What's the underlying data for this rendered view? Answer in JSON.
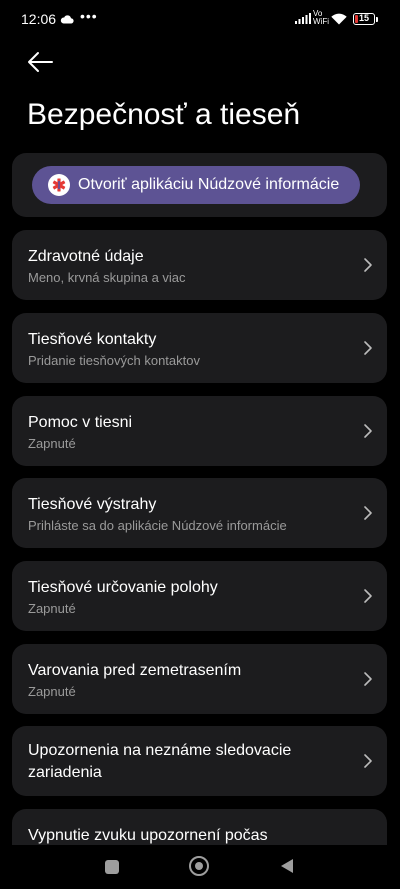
{
  "status": {
    "time": "12:06",
    "volte_line1": "Vo",
    "volte_line2": "WiFi",
    "battery": "15",
    "battery_level": 0.15,
    "battery_color": "#e53935"
  },
  "icons": {
    "back": "arrow-left-icon",
    "cloud": "cloud-icon",
    "signal": "signal-bars-icon",
    "wifi": "wifi-icon",
    "chevron": "chevron-right-icon",
    "emergency": "emergency-star-of-life-icon"
  },
  "page": {
    "title": "Bezpečnosť a tieseň"
  },
  "emergency_app": {
    "button_label": "Otvoriť aplikáciu Núdzové informácie",
    "accent": "#5d5394"
  },
  "items": [
    {
      "title": "Zdravotné údaje",
      "subtitle": "Meno, krvná skupina a viac"
    },
    {
      "title": "Tiesňové kontakty",
      "subtitle": "Pridanie tiesňových kontaktov"
    },
    {
      "title": "Pomoc v tiesni",
      "subtitle": "Zapnuté"
    },
    {
      "title": "Tiesňové výstrahy",
      "subtitle": "Prihláste sa do aplikácie Núdzové informácie"
    },
    {
      "title": "Tiesňové určovanie polohy",
      "subtitle": "Zapnuté"
    },
    {
      "title": "Varovania pred zemetrasením",
      "subtitle": "Zapnuté"
    },
    {
      "title_line1": "Upozornenia na neznáme sledovacie",
      "title_line2": "zariadenia"
    },
    {
      "title": "Vypnutie zvuku upozornení počas"
    }
  ]
}
